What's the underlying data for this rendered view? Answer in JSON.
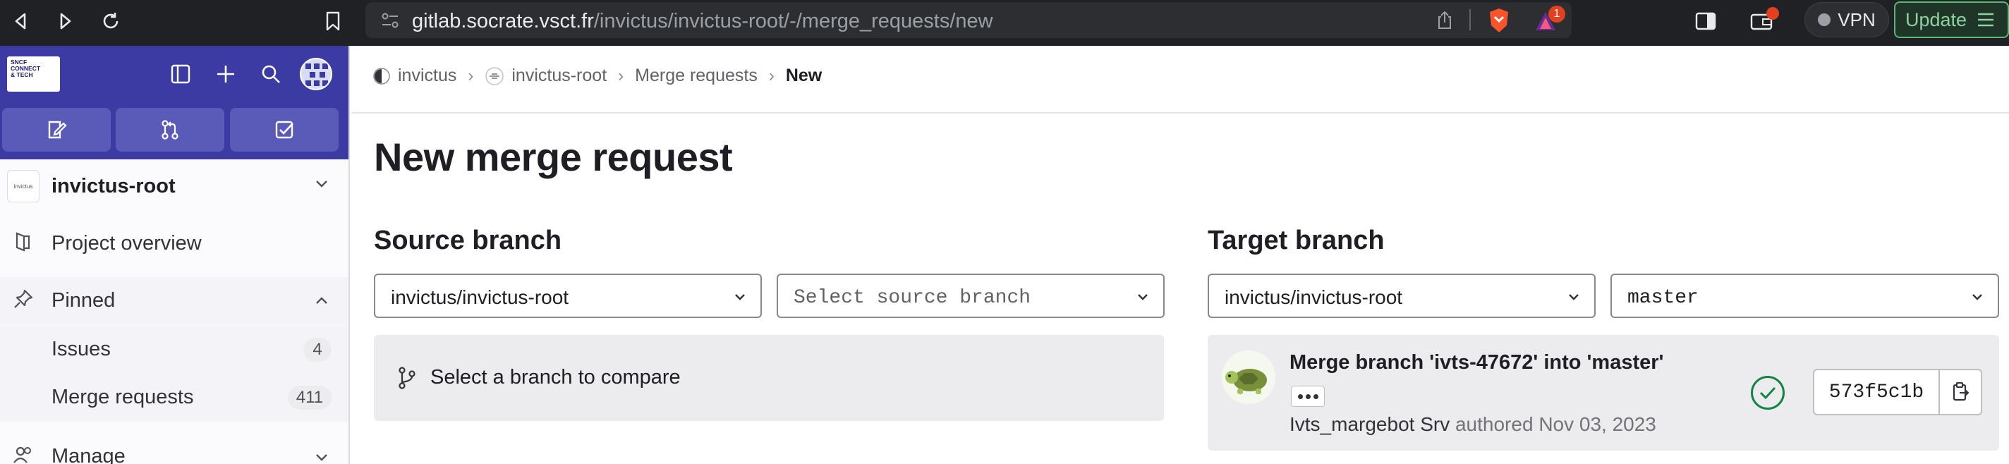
{
  "browser": {
    "url_host": "gitlab.socrate.vsct.fr",
    "url_path": "/invictus/invictus-root/-/merge_requests/new",
    "notification_count": "1",
    "vpn_label": "VPN",
    "update_label": "Update"
  },
  "sidebar": {
    "logo_text": [
      "SNCF",
      "CONNECT",
      "& TECH"
    ],
    "project_avatar_text": "invictus",
    "project_name": "invictus-root",
    "items": [
      {
        "label": "Project overview"
      },
      {
        "label": "Pinned"
      },
      {
        "label": "Issues",
        "count": "4"
      },
      {
        "label": "Merge requests",
        "count": "411"
      },
      {
        "label": "Manage"
      }
    ]
  },
  "breadcrumb": {
    "items": [
      "invictus",
      "invictus-root",
      "Merge requests",
      "New"
    ],
    "separator": "›"
  },
  "page": {
    "title": "New merge request"
  },
  "source": {
    "title": "Source branch",
    "project": "invictus/invictus-root",
    "branch_placeholder": "Select source branch",
    "compare_hint": "Select a branch to compare"
  },
  "target": {
    "title": "Target branch",
    "project": "invictus/invictus-root",
    "branch": "master",
    "commit": {
      "title": "Merge branch 'ivts-47672' into 'master'",
      "author": "Ivts_margebot Srv",
      "authored_label": "authored",
      "date": "Nov 03, 2023",
      "sha": "573f5c1b"
    }
  },
  "colors": {
    "sidebar_header": "#3b3ba3",
    "pipeline_success": "#108548"
  }
}
